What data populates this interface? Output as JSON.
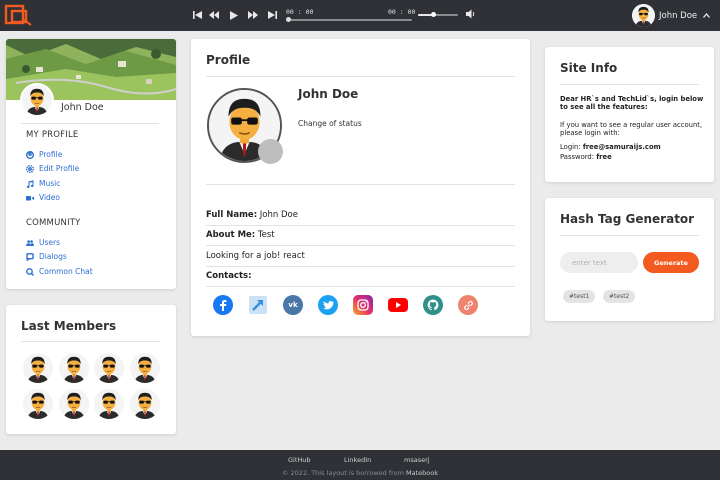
{
  "topbar": {
    "time_current": "00 : 00",
    "time_total": "00 : 00",
    "volume_level": 0.38,
    "user_name": "John Doe"
  },
  "left": {
    "user_name": "John Doe",
    "my_profile_title": "MY PROFILE",
    "my_profile_links": [
      {
        "label": "Profile",
        "icon": "user-circle-icon"
      },
      {
        "label": "Edit Profile",
        "icon": "cog-icon"
      },
      {
        "label": "Music",
        "icon": "music-note-icon"
      },
      {
        "label": "Video",
        "icon": "video-camera-icon"
      }
    ],
    "community_title": "COMMUNITY",
    "community_links": [
      {
        "label": "Users",
        "icon": "users-icon"
      },
      {
        "label": "Dialogs",
        "icon": "chat-bubble-icon"
      },
      {
        "label": "Common Chat",
        "icon": "chat-search-icon"
      }
    ]
  },
  "members": {
    "title": "Last Members"
  },
  "profile": {
    "title": "Profile",
    "name": "John Doe",
    "status": "Change of status",
    "full_name_label": "Full Name:",
    "full_name": "John Doe",
    "about_label": "About Me:",
    "about": "Test",
    "looking_for_job": "Looking for a job! react",
    "contacts_label": "Contacts:",
    "contacts": [
      {
        "icon": "facebook-icon",
        "color": "#1877f2"
      },
      {
        "icon": "external-link-icon",
        "color": "#4aa3df"
      },
      {
        "icon": "vk-icon",
        "color": "#4a76a8"
      },
      {
        "icon": "twitter-icon",
        "color": "#1da1f2"
      },
      {
        "icon": "instagram-icon",
        "color": "#d6249f"
      },
      {
        "icon": "youtube-icon",
        "color": "#ff0000"
      },
      {
        "icon": "github-icon",
        "color": "#2f8f8a"
      },
      {
        "icon": "link-icon",
        "color": "#f0836e"
      }
    ]
  },
  "site_info": {
    "title": "Site Info",
    "intro": "Dear HR`s and TechLid`s, login below to see all the features:",
    "regular_note": "If you want to see a regular user account, please login with:",
    "login_label": "Login:",
    "login_value": "free@samuraijs.com",
    "password_label": "Password:",
    "password_value": "free"
  },
  "hashtag": {
    "title": "Hash Tag Generator",
    "placeholder": "enter text",
    "button": "Generate",
    "tags": [
      "#test1",
      "#test2"
    ]
  },
  "footer": {
    "links": [
      "GitHub",
      "LinkedIn",
      "msaserj"
    ],
    "copyright": "© 2022. This layout is borrowed from",
    "source": "Matebook"
  },
  "colors": {
    "bar_bg": "#2f3136",
    "accent": "#f25a20",
    "link": "#2d6fd0"
  }
}
